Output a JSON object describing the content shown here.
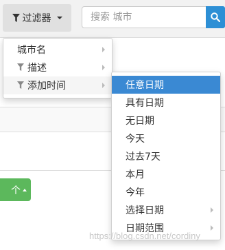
{
  "toolbar": {
    "filter_label": "过滤器",
    "search_placeholder": "搜索 城市"
  },
  "filter_menu": {
    "items": [
      {
        "label": "城市名",
        "icon": "",
        "has_submenu": true
      },
      {
        "label": "描述",
        "icon": "funnel-icon",
        "has_submenu": true
      },
      {
        "label": "添加时间",
        "icon": "funnel-icon",
        "has_submenu": true
      }
    ]
  },
  "date_menu": {
    "items": [
      {
        "label": "任意日期",
        "has_submenu": false,
        "active": true
      },
      {
        "label": "具有日期",
        "has_submenu": false
      },
      {
        "label": "无日期",
        "has_submenu": false
      },
      {
        "label": "今天",
        "has_submenu": false
      },
      {
        "label": "过去7天",
        "has_submenu": false
      },
      {
        "label": "本月",
        "has_submenu": false
      },
      {
        "label": "今年",
        "has_submenu": false
      },
      {
        "label": "选择日期",
        "has_submenu": true
      },
      {
        "label": "日期范围",
        "has_submenu": true
      }
    ]
  },
  "action_button": {
    "label": "个"
  },
  "watermark": "https://blog.csdn.net/cordiny",
  "colors": {
    "primary": "#2d8fd5",
    "active_item": "#3a89d3",
    "success": "#5cb85c"
  }
}
